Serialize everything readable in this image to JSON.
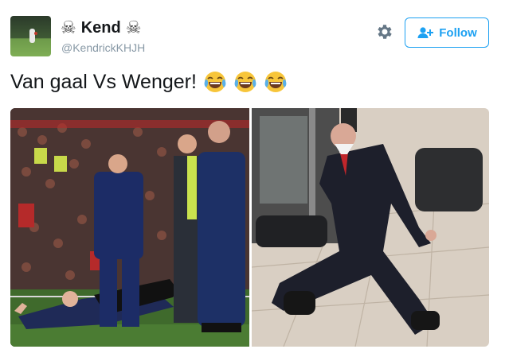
{
  "user": {
    "display_name": "Kend",
    "name_decoration": "☠",
    "handle": "@KendrickKHJH"
  },
  "actions": {
    "follow_label": "Follow",
    "settings_icon": "gear-icon",
    "follow_icon": "add-user-icon"
  },
  "tweet": {
    "text": "Van gaal Vs Wenger!",
    "emojis": [
      "face-with-tears-of-joy",
      "face-with-tears-of-joy",
      "face-with-tears-of-joy"
    ]
  },
  "media": [
    {
      "type": "photo",
      "description_icon": "football-touchline-photo"
    },
    {
      "type": "photo",
      "description_icon": "man-falling-photo"
    }
  ],
  "colors": {
    "accent": "#1da1f2",
    "handle": "#8899a6",
    "text": "#14171a",
    "gear": "#657786"
  }
}
